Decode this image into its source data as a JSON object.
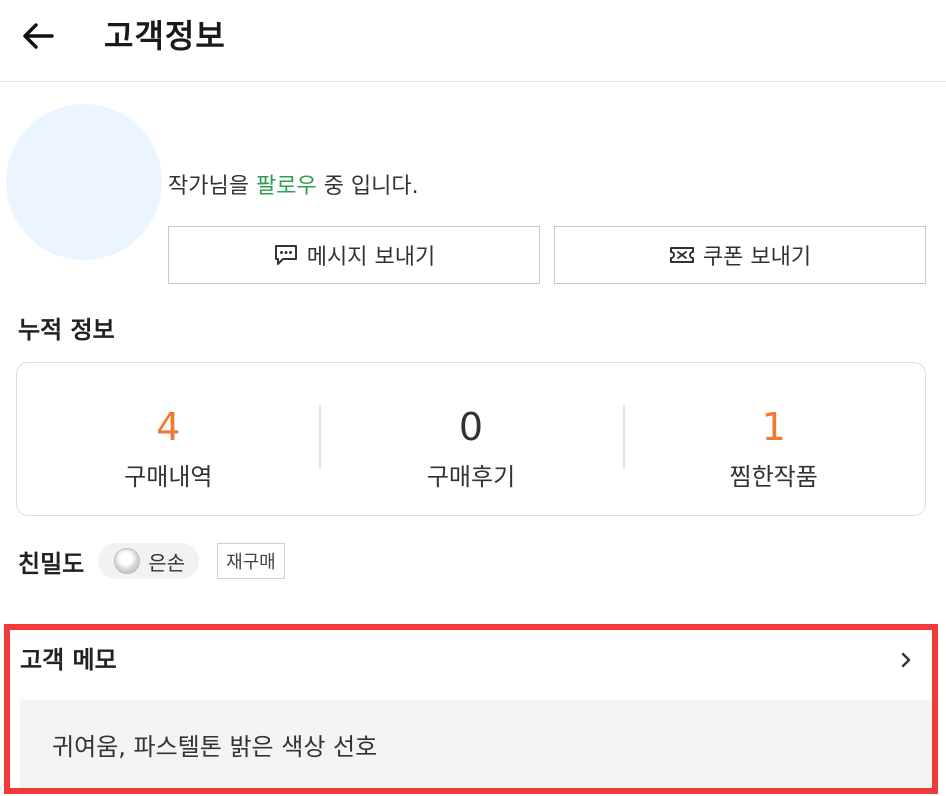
{
  "header": {
    "title": "고객정보",
    "back_icon": "arrow-left-icon"
  },
  "profile": {
    "avatar_color": "#eaf5ff",
    "follow_text_before": "작가님을 ",
    "follow_text_highlight": "팔로우",
    "follow_text_after": " 중 입니다.",
    "highlight_color": "#2e9e4f"
  },
  "actions": {
    "message_label": "메시지 보내기",
    "message_icon": "chat-bubble-icon",
    "coupon_label": "쿠폰 보내기",
    "coupon_icon": "coupon-icon"
  },
  "stats_section": {
    "title": "누적 정보",
    "items": [
      {
        "value": "4",
        "label": "구매내역",
        "color": "#ef7b30"
      },
      {
        "value": "0",
        "label": "구매후기",
        "color": "#333333"
      },
      {
        "value": "1",
        "label": "찜한작품",
        "color": "#ef7b30"
      }
    ]
  },
  "intimacy": {
    "label": "친밀도",
    "grade": "은손",
    "grade_icon": "silver-hand-icon",
    "tag": "재구매"
  },
  "memo": {
    "title": "고객 메모",
    "content": "귀여움, 파스텔톤 밝은 색상 선호",
    "chevron_icon": "chevron-right-icon",
    "highlight_border_color": "#f23a3c"
  }
}
